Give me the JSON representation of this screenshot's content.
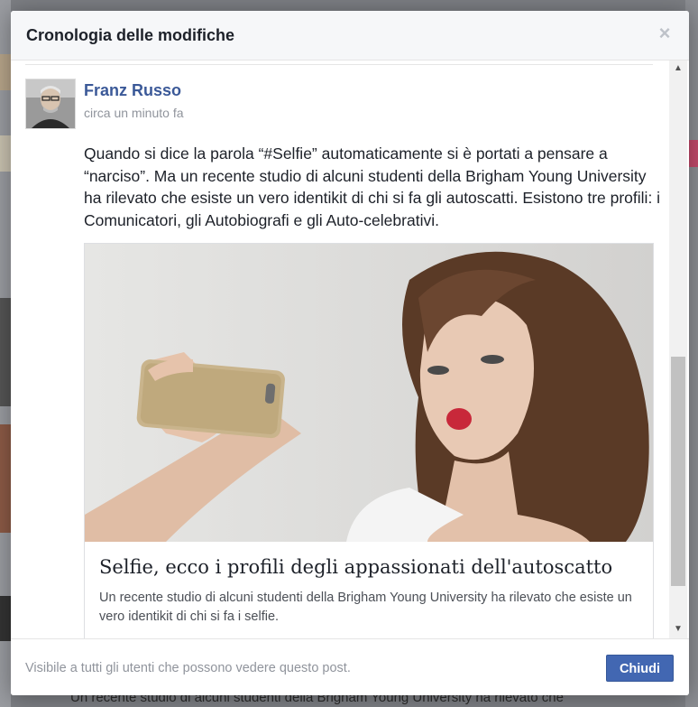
{
  "dialog": {
    "title": "Cronologia delle modifiche",
    "close_icon": "close-icon"
  },
  "post": {
    "author": "Franz Russo",
    "time": "circa un minuto fa",
    "text": "Quando si dice la parola “#Selfie” automaticamente si è portati a pensare a “narciso”. Ma un recente studio di alcuni studenti della Brigham Young University ha rilevato che esiste un vero identikit di chi si fa gli autoscatti. Esistono tre profili: i Comunicatori, gli Autobiografi e gli Auto-celebrativi.",
    "link": {
      "title": "Selfie, ecco i profili degli appassionati dell'autoscatto",
      "description": "Un recente studio di alcuni studenti della Brigham Young University ha rilevato che esiste un vero identikit di chi si fa i selfie."
    }
  },
  "footer": {
    "visibility": "Visibile a tutti gli utenti che possono vedere questo post.",
    "close_label": "Chiudi"
  },
  "background": {
    "bottom_text": "Un recente studio di alcuni studenti della Brigham Young University ha rilevato che"
  },
  "colors": {
    "link_blue": "#3b5998",
    "button_blue": "#4267b2",
    "overlay": "#7d7f84"
  }
}
